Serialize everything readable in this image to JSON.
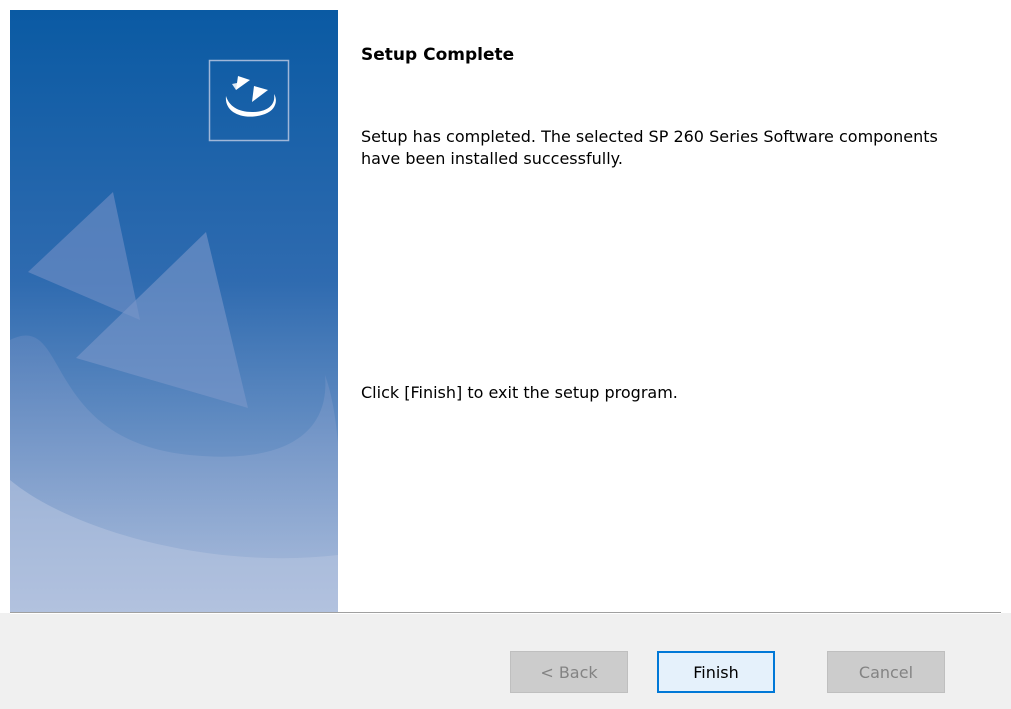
{
  "dialog": {
    "heading": "Setup Complete",
    "message": "Setup has completed. The selected SP 260 Series Software components have been installed successfully.",
    "instruction": "Click [Finish] to exit the setup program."
  },
  "buttons": {
    "back_label": "< Back",
    "finish_label": "Finish",
    "cancel_label": "Cancel"
  },
  "colors": {
    "banner_top": "#0a5aa3",
    "banner_bottom": "#9fb2d4",
    "default_button_border": "#0078d7"
  },
  "icons": {
    "banner_logo": "installer-logo-icon"
  }
}
